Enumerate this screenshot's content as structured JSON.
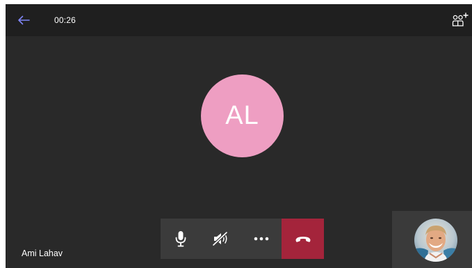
{
  "call": {
    "timer": "00:26"
  },
  "remote_participant": {
    "initials": "AL",
    "name": "Ami Lahav",
    "avatar_color": "#ee9ec2"
  },
  "controls": {
    "microphone": "microphone-icon",
    "speaker": "speaker-muted-icon",
    "more": "more-options-icon",
    "hangup": "hang-up-icon",
    "hangup_color": "#a4243b"
  },
  "colors": {
    "background": "#292929",
    "topbar": "#1f1f1f",
    "accent": "#6264a7",
    "control_bar": "#3b3b3b"
  }
}
